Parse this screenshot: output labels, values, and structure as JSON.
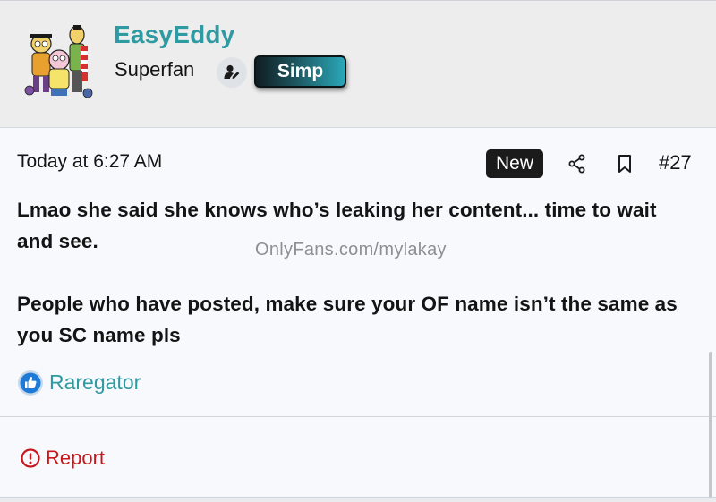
{
  "user": {
    "username": "EasyEddy",
    "title": "Superfan",
    "banner": "Simp",
    "avatar_icon": "cartoon-trio-avatar",
    "staff_icon": "user-edit-icon"
  },
  "message": {
    "timestamp": "Today at 6:27 AM",
    "badge": "New",
    "post_number": "#27",
    "paragraph1": "Lmao she said she knows who’s leaking her content... time to wait and see.",
    "watermark": "OnlyFans.com/mylakay",
    "paragraph2": "People who have posted, make sure your OF name isn’t the same as you SC name pls"
  },
  "reactions": {
    "icon": "thumbs-up-icon",
    "user": "Raregator"
  },
  "actions": {
    "report_label": "Report"
  },
  "colors": {
    "accent": "#2e9aa1",
    "report": "#c8171c",
    "badge_bg": "#1b1b1b"
  }
}
